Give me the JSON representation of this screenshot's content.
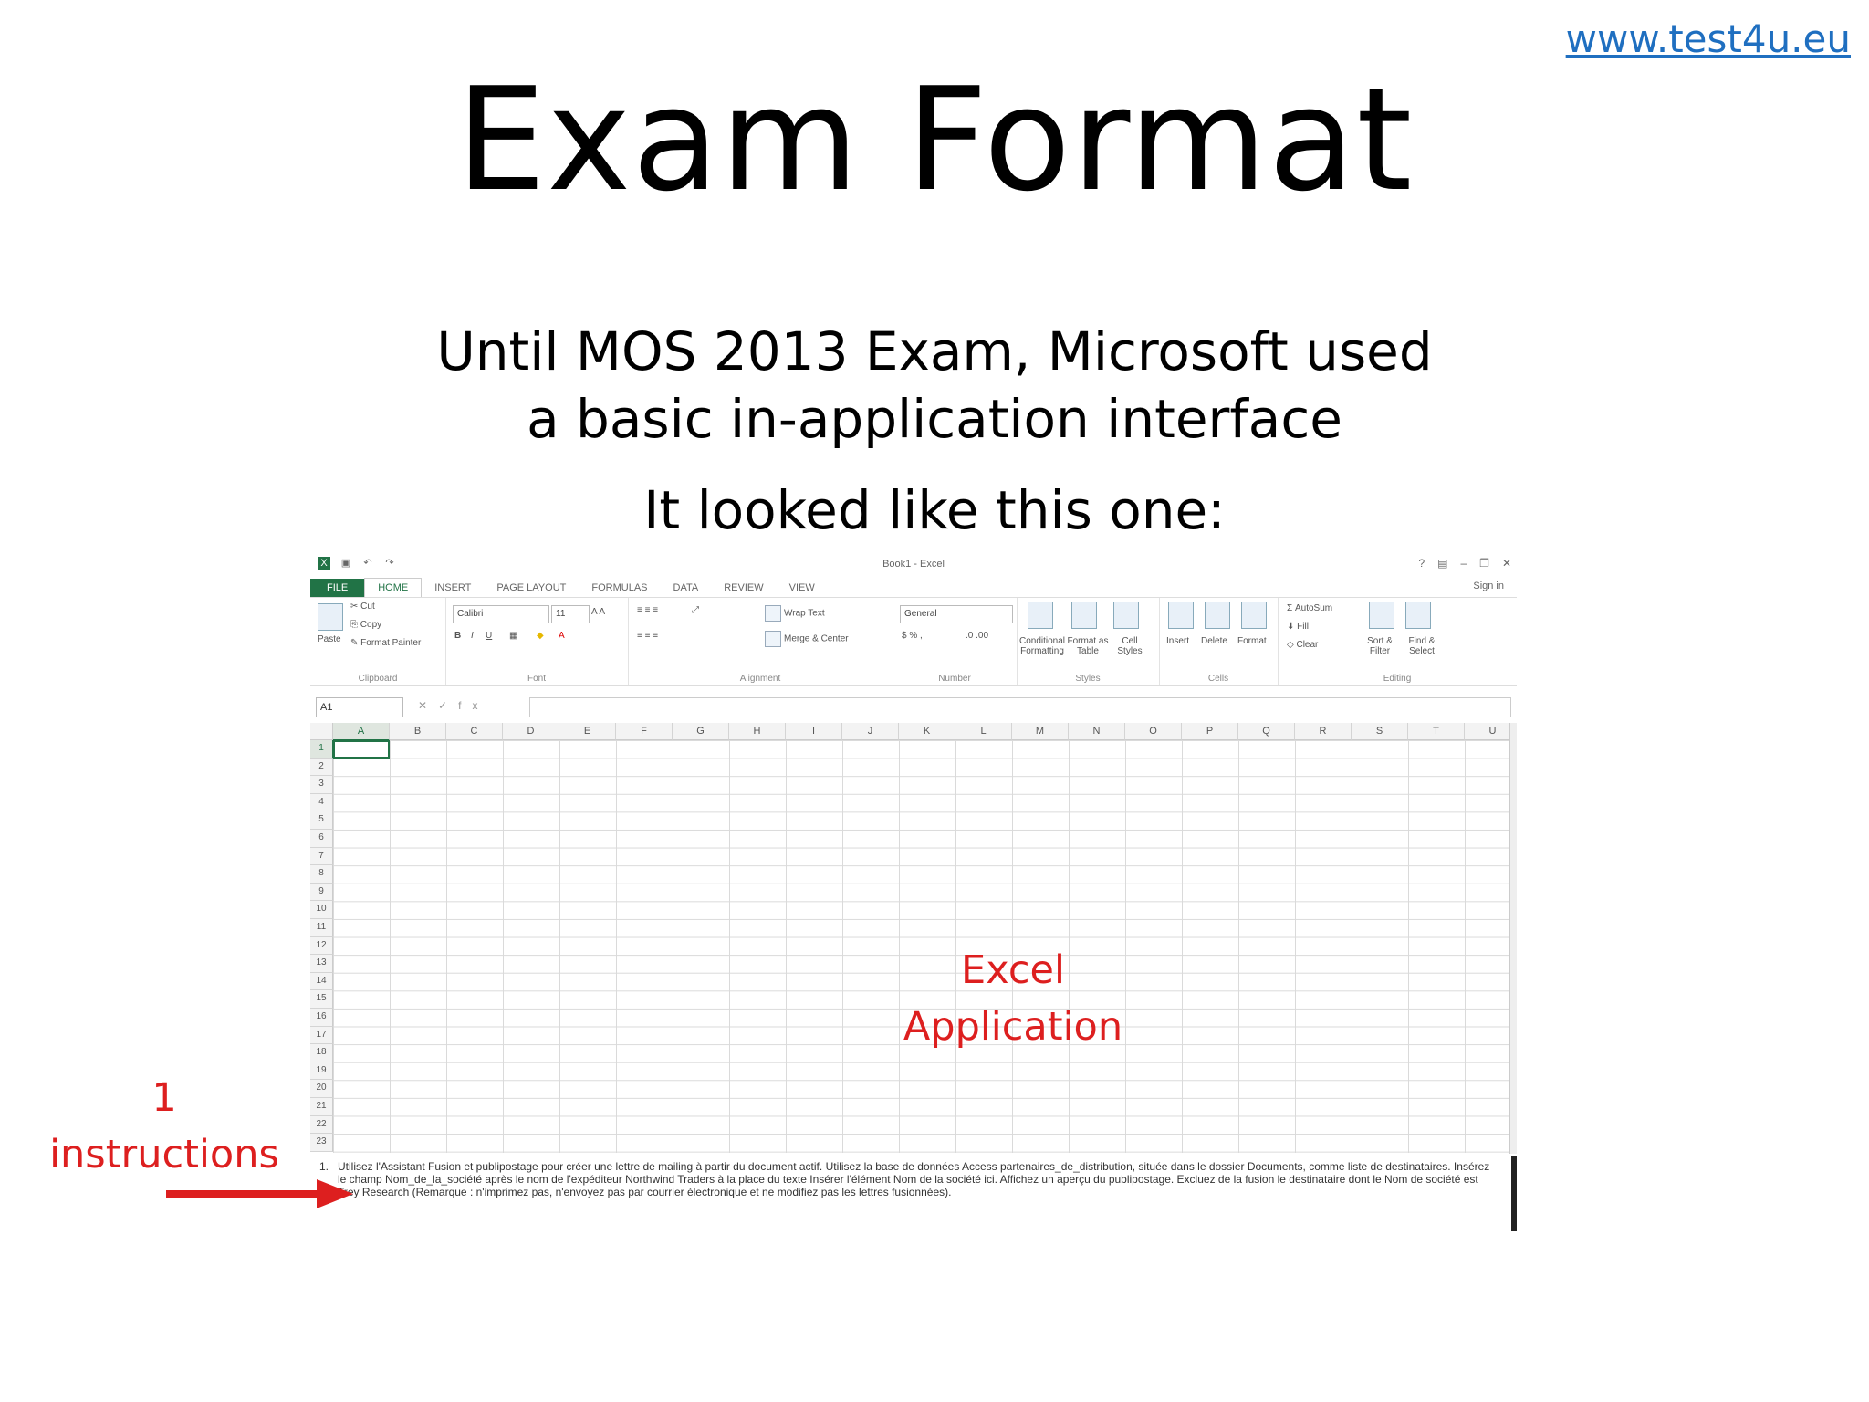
{
  "link": "www.test4u.eu",
  "title": "Exam Format",
  "subtitle_line1": "Until MOS 2013 Exam, Microsoft used",
  "subtitle_line2": "a basic in-application interface",
  "subtitle2": "It looked like this one:",
  "excel": {
    "window_title": "Book1 - Excel",
    "tabs": [
      "FILE",
      "HOME",
      "INSERT",
      "PAGE LAYOUT",
      "FORMULAS",
      "DATA",
      "REVIEW",
      "VIEW"
    ],
    "sign_in": "Sign in",
    "clipboard": {
      "paste": "Paste",
      "cut": "Cut",
      "copy": "Copy",
      "format_painter": "Format Painter",
      "label": "Clipboard"
    },
    "font": {
      "name": "Calibri",
      "size": "11",
      "label": "Font"
    },
    "alignment": {
      "wrap_text": "Wrap Text",
      "merge_center": "Merge & Center",
      "label": "Alignment"
    },
    "number": {
      "format": "General",
      "label": "Number"
    },
    "styles": {
      "conditional": "Conditional Formatting",
      "format_table": "Format as Table",
      "cell_styles": "Cell Styles",
      "label": "Styles"
    },
    "cells": {
      "insert": "Insert",
      "delete": "Delete",
      "format": "Format",
      "label": "Cells"
    },
    "editing": {
      "autosum": "AutoSum",
      "fill": "Fill",
      "clear": "Clear",
      "sort": "Sort & Filter",
      "find": "Find & Select",
      "label": "Editing"
    },
    "name_box": "A1",
    "fx": "fx",
    "columns": [
      "A",
      "B",
      "C",
      "D",
      "E",
      "F",
      "G",
      "H",
      "I",
      "J",
      "K",
      "L",
      "M",
      "N",
      "O",
      "P",
      "Q",
      "R",
      "S",
      "T",
      "U"
    ],
    "rows": [
      "1",
      "2",
      "3",
      "4",
      "5",
      "6",
      "7",
      "8",
      "9",
      "10",
      "11",
      "12",
      "13",
      "14",
      "15",
      "16",
      "17",
      "18",
      "19",
      "20",
      "21",
      "22",
      "23"
    ],
    "overlay_label_line1": "Excel",
    "overlay_label_line2": "Application",
    "instruction_number": "1.",
    "instructions": "Utilisez l'Assistant Fusion et publipostage pour créer une lettre de mailing à partir du document actif. Utilisez la base de données Access partenaires_de_distribution, située dans le dossier Documents, comme liste de destinataires. Insérez le champ Nom_de_la_société après le nom de l'expéditeur Northwind Traders à la place du texte Insérer l'élément Nom de la société ici. Affichez un aperçu du publipostage. Excluez de la fusion le destinataire dont le Nom de société est Trey Research (Remarque : n'imprimez pas, n'envoyez pas par courrier électronique et ne modifiez pas les lettres fusionnées)."
  },
  "annotation_line1": "1",
  "annotation_line2": "instructions",
  "colors": {
    "accent_red": "#dd1f1f",
    "link_blue": "#1f6fc0",
    "excel_green": "#217346"
  }
}
